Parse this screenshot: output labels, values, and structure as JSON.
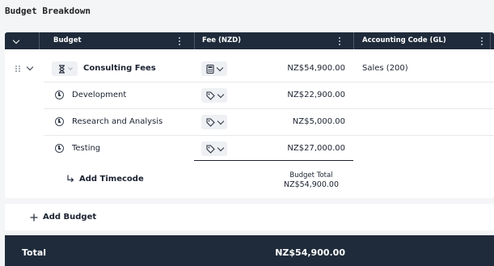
{
  "page": {
    "title": "Budget Breakdown"
  },
  "table": {
    "headers": {
      "budget": "Budget",
      "fee": "Fee (NZD)",
      "accounting_code": "Accounting Code (GL)"
    },
    "parent": {
      "name": "Consulting Fees",
      "fee": "NZ$54,900.00",
      "accounting_code": "Sales (200)"
    },
    "children": [
      {
        "name": "Development",
        "fee": "NZ$22,900.00"
      },
      {
        "name": "Research and Analysis",
        "fee": "NZ$5,000.00"
      },
      {
        "name": "Testing",
        "fee": "NZ$27,000.00"
      }
    ],
    "add_timecode": "Add Timecode",
    "budget_total_label": "Budget Total",
    "budget_total_value": "NZ$54,900.00"
  },
  "add_budget": "Add Budget",
  "total": {
    "label": "Total",
    "value": "NZ$54,900.00"
  }
}
